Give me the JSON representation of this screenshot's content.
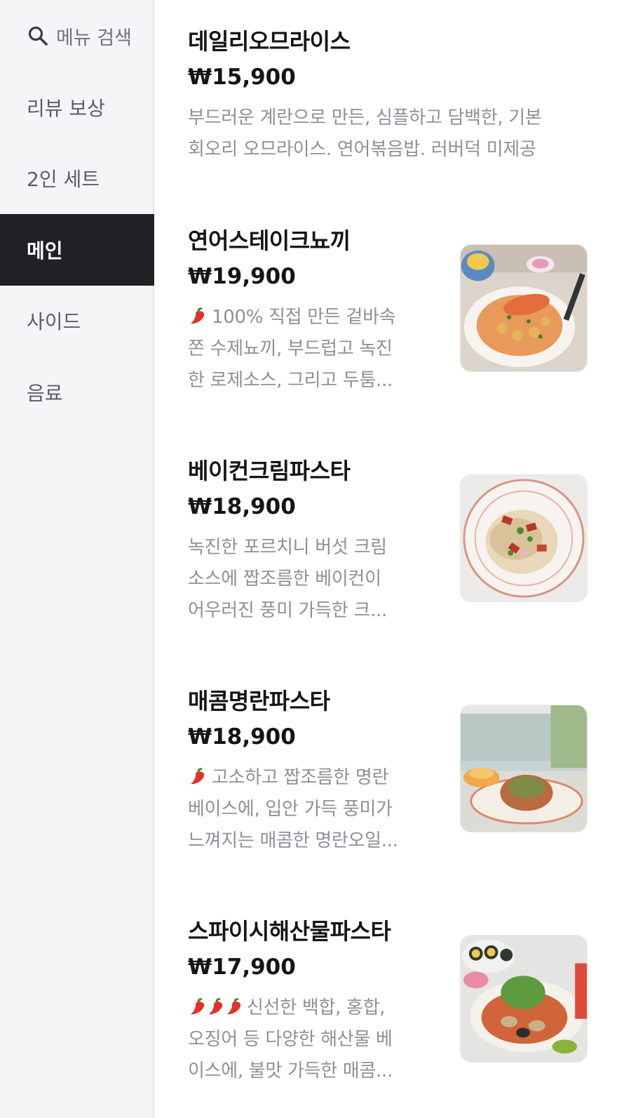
{
  "sidebar": {
    "search_label": "메뉴 검색",
    "items": [
      {
        "label": "리뷰 보상"
      },
      {
        "label": "2인 세트"
      },
      {
        "label": "메인"
      },
      {
        "label": "사이드"
      },
      {
        "label": "음료"
      }
    ],
    "active_index": 2,
    "active_bg": "#1f2124",
    "bg": "#f4f5f7"
  },
  "menu": [
    {
      "name": "데일리오므라이스",
      "price": "₩15,900",
      "desc_lines": [
        "부드러운 계란으로 만든, 심플하고 담백한, 기본",
        "회오리 오므라이스. 연어볶음밥. 러버덕 미제공"
      ],
      "spicy": 0,
      "image": null
    },
    {
      "name": "연어스테이크뇨끼",
      "price": "₩19,900",
      "desc_lines": [
        "100% 직접 만든 겉바속",
        "쫀 수제뇨끼, 부드럽고 녹진",
        "한 로제소스, 그리고 두툼..."
      ],
      "spicy": 1,
      "image": "salmon-steak-gnocchi-photo"
    },
    {
      "name": "베이컨크림파스타",
      "price": "₩18,900",
      "desc_lines": [
        "녹진한 포르치니 버섯 크림",
        "소스에 짭조름한 베이컨이",
        "어우러진 풍미 가득한 크..."
      ],
      "spicy": 0,
      "image": "bacon-cream-pasta-photo"
    },
    {
      "name": "매콤명란파스타",
      "price": "₩18,900",
      "desc_lines": [
        "고소하고 짭조름한 명란",
        "베이스에, 입안 가득 풍미가",
        "느껴지는 매콤한 명란오일..."
      ],
      "spicy": 1,
      "image": "spicy-mentaiko-pasta-photo"
    },
    {
      "name": "스파이시해산물파스타",
      "price": "₩17,900",
      "desc_lines": [
        "신선한 백합, 홍합,",
        "오징어 등 다양한 해산물 베",
        "이스에, 불맛 가득한 매콤..."
      ],
      "spicy": 3,
      "image": "spicy-seafood-pasta-photo"
    }
  ]
}
